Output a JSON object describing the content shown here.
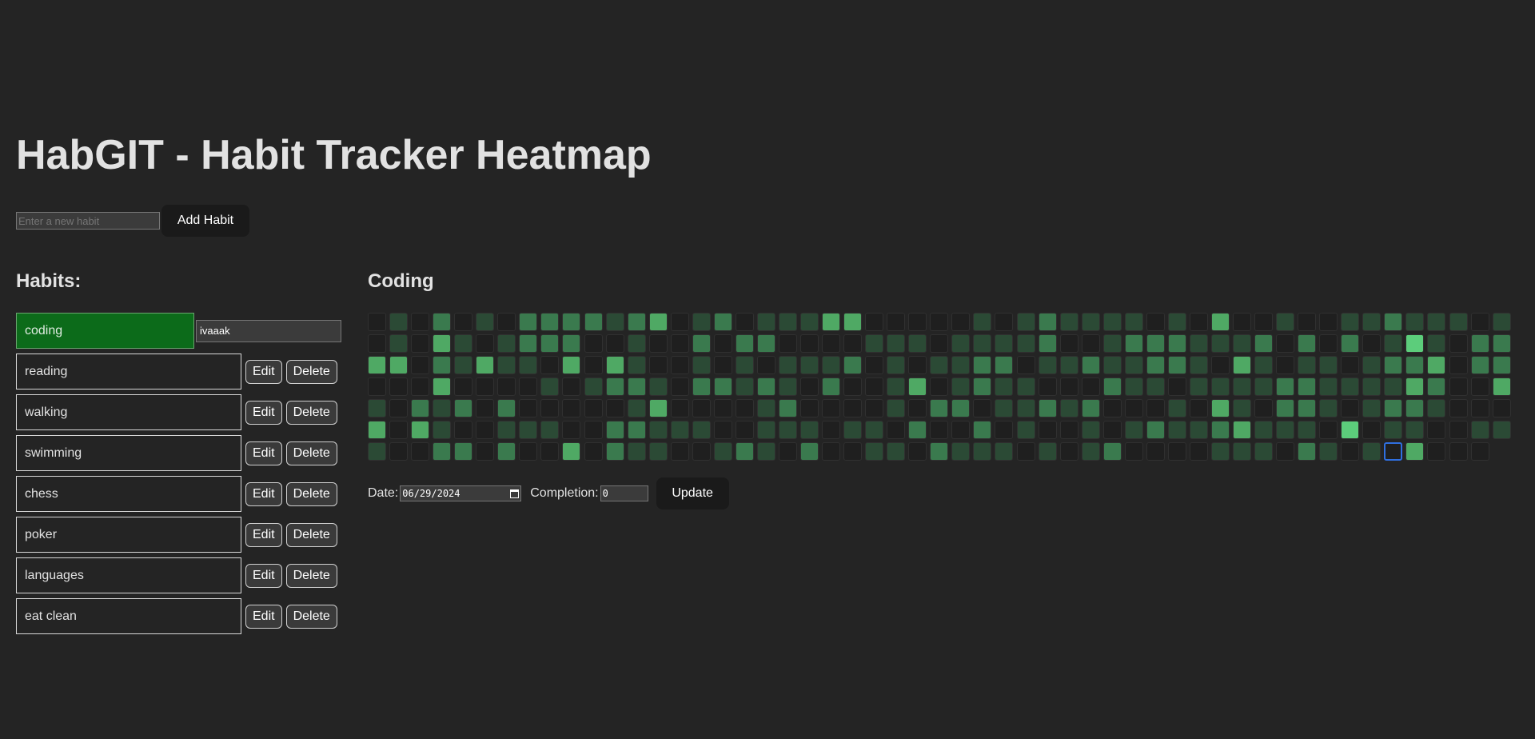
{
  "app": {
    "title": "HabGIT - Habit Tracker Heatmap",
    "new_habit_placeholder": "Enter a new habit",
    "add_button": "Add Habit"
  },
  "habits": {
    "heading": "Habits:",
    "edit_label": "Edit",
    "delete_label": "Delete",
    "selected": "coding",
    "edit_value": "ivaaak",
    "items": [
      {
        "name": "coding"
      },
      {
        "name": "reading"
      },
      {
        "name": "walking"
      },
      {
        "name": "swimming"
      },
      {
        "name": "chess"
      },
      {
        "name": "poker"
      },
      {
        "name": "languages"
      },
      {
        "name": "eat clean"
      }
    ]
  },
  "detail": {
    "title": "Coding",
    "date_label": "Date:",
    "date_value": "06/29/2024",
    "completion_label": "Completion:",
    "completion_value": "0",
    "update_button": "Update"
  },
  "colors": {
    "background": "#242424",
    "level_0": "#1f1f1f",
    "level_1": "#2b4a35",
    "level_2": "#3a7a4e",
    "level_3": "#4fa964",
    "level_4": "#5ccd7b",
    "selected_day_border": "#2f6fe0",
    "active_habit": "#0c6b1a"
  },
  "heatmap": {
    "weeks": 53,
    "days_per_week": 7,
    "selected_cell": {
      "week": 47,
      "day": 6
    },
    "levels_by_week": [
      [
        0,
        0,
        3,
        0,
        1,
        3,
        1
      ],
      [
        1,
        1,
        3,
        0,
        0,
        0,
        0
      ],
      [
        0,
        0,
        0,
        0,
        2,
        3,
        0
      ],
      [
        2,
        3,
        2,
        3,
        1,
        1,
        2
      ],
      [
        0,
        1,
        1,
        0,
        2,
        0,
        2
      ],
      [
        1,
        0,
        3,
        0,
        0,
        0,
        0
      ],
      [
        0,
        1,
        1,
        0,
        2,
        1,
        2
      ],
      [
        2,
        2,
        1,
        0,
        0,
        1,
        0
      ],
      [
        2,
        2,
        0,
        1,
        0,
        1,
        0
      ],
      [
        2,
        2,
        3,
        0,
        0,
        0,
        3
      ],
      [
        2,
        0,
        0,
        1,
        0,
        0,
        0
      ],
      [
        1,
        0,
        3,
        2,
        0,
        2,
        2
      ],
      [
        2,
        1,
        1,
        2,
        1,
        2,
        1
      ],
      [
        3,
        0,
        0,
        1,
        3,
        1,
        1
      ],
      [
        0,
        0,
        0,
        0,
        0,
        1,
        0
      ],
      [
        1,
        2,
        1,
        2,
        0,
        1,
        0
      ],
      [
        2,
        0,
        0,
        2,
        0,
        0,
        1
      ],
      [
        0,
        2,
        1,
        1,
        0,
        0,
        2
      ],
      [
        1,
        2,
        0,
        2,
        1,
        1,
        1
      ],
      [
        1,
        0,
        1,
        1,
        2,
        1,
        0
      ],
      [
        1,
        0,
        1,
        0,
        0,
        1,
        2
      ],
      [
        3,
        0,
        1,
        2,
        0,
        0,
        0
      ],
      [
        3,
        0,
        2,
        0,
        0,
        1,
        0
      ],
      [
        0,
        1,
        0,
        0,
        0,
        1,
        1
      ],
      [
        0,
        1,
        1,
        1,
        1,
        0,
        1
      ],
      [
        0,
        1,
        0,
        3,
        0,
        2,
        0
      ],
      [
        0,
        0,
        1,
        0,
        2,
        0,
        2
      ],
      [
        0,
        1,
        1,
        1,
        2,
        0,
        1
      ],
      [
        1,
        1,
        2,
        2,
        0,
        2,
        1
      ],
      [
        0,
        1,
        2,
        1,
        1,
        0,
        1
      ],
      [
        1,
        1,
        0,
        1,
        1,
        1,
        0
      ],
      [
        2,
        2,
        1,
        0,
        2,
        0,
        1
      ],
      [
        1,
        0,
        1,
        0,
        1,
        0,
        0
      ],
      [
        1,
        0,
        2,
        0,
        2,
        1,
        1
      ],
      [
        1,
        1,
        1,
        2,
        0,
        0,
        2
      ],
      [
        1,
        2,
        1,
        1,
        0,
        1,
        0
      ],
      [
        0,
        2,
        2,
        1,
        0,
        2,
        0
      ],
      [
        1,
        2,
        2,
        0,
        1,
        1,
        0
      ],
      [
        0,
        1,
        1,
        1,
        0,
        1,
        0
      ],
      [
        3,
        1,
        0,
        1,
        3,
        2,
        1
      ],
      [
        0,
        1,
        3,
        1,
        1,
        3,
        1
      ],
      [
        0,
        2,
        1,
        1,
        0,
        1,
        1
      ],
      [
        1,
        0,
        0,
        2,
        2,
        1,
        0
      ],
      [
        0,
        2,
        1,
        2,
        2,
        1,
        2
      ],
      [
        0,
        0,
        1,
        1,
        1,
        0,
        1
      ],
      [
        1,
        2,
        0,
        1,
        0,
        4,
        0
      ],
      [
        1,
        0,
        1,
        1,
        1,
        0,
        1
      ],
      [
        2,
        1,
        2,
        1,
        2,
        1,
        0
      ],
      [
        1,
        4,
        2,
        3,
        2,
        1,
        3
      ],
      [
        1,
        1,
        3,
        2,
        1,
        0,
        0
      ],
      [
        1,
        0,
        0,
        0,
        0,
        0,
        0
      ],
      [
        0,
        2,
        2,
        0,
        0,
        1,
        0
      ],
      [
        1,
        2,
        2,
        3,
        0,
        1,
        0
      ]
    ]
  }
}
